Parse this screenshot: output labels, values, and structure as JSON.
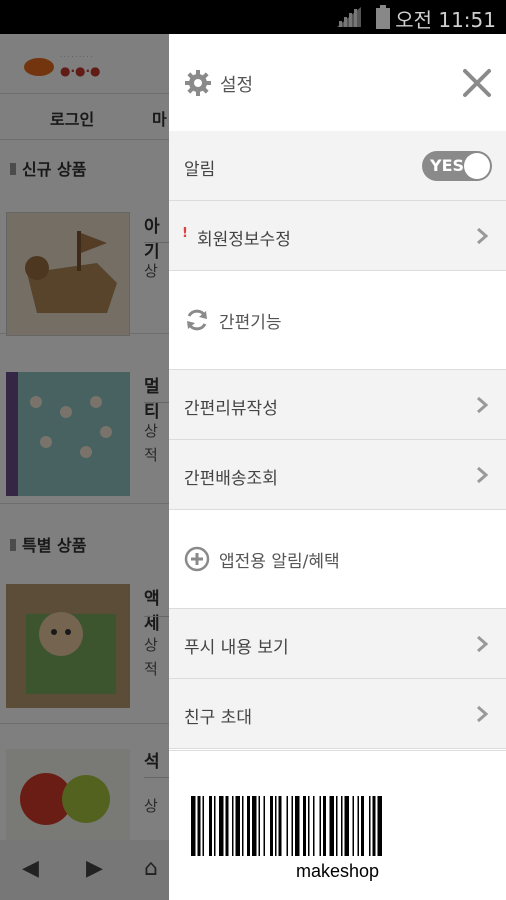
{
  "status_bar": {
    "time": "오전 11:51"
  },
  "background_app": {
    "nav": [
      "로그인",
      "마"
    ],
    "sections": [
      {
        "title": "신규 상품",
        "products": [
          {
            "title": "아기",
            "sub": "상"
          },
          {
            "title": "멀티",
            "sub": "상",
            "sub2": "적"
          }
        ]
      },
      {
        "title": "특별 상품",
        "products": [
          {
            "title": "액세",
            "sub": "상",
            "sub2": "적"
          },
          {
            "title": "석",
            "sub": "상"
          }
        ]
      }
    ],
    "footer": {
      "back": "◀",
      "forward": "▶",
      "home": "⌂"
    }
  },
  "drawer": {
    "title": "설정",
    "title_icon": "gear-icon",
    "close_icon": "close-icon",
    "rows": [
      {
        "label": "알림",
        "type": "toggle",
        "toggle_label": "YES",
        "toggle_on": true
      },
      {
        "label": "회원정보수정",
        "type": "link",
        "notice": "!"
      }
    ],
    "sections": [
      {
        "label": "간편기능",
        "icon": "refresh-icon",
        "items": [
          {
            "label": "간편리뷰작성"
          },
          {
            "label": "간편배송조회"
          }
        ]
      },
      {
        "label": "앱전용 알림/혜택",
        "icon": "plus-circle-icon",
        "items": [
          {
            "label": "푸시 내용 보기"
          },
          {
            "label": "친구 초대"
          }
        ]
      }
    ],
    "barcode_text": "makeshop"
  },
  "colors": {
    "toggle_bg": "#8a8a8a",
    "row_bg": "#f3f3f3",
    "overlay": "rgba(0,0,0,0.5)"
  }
}
